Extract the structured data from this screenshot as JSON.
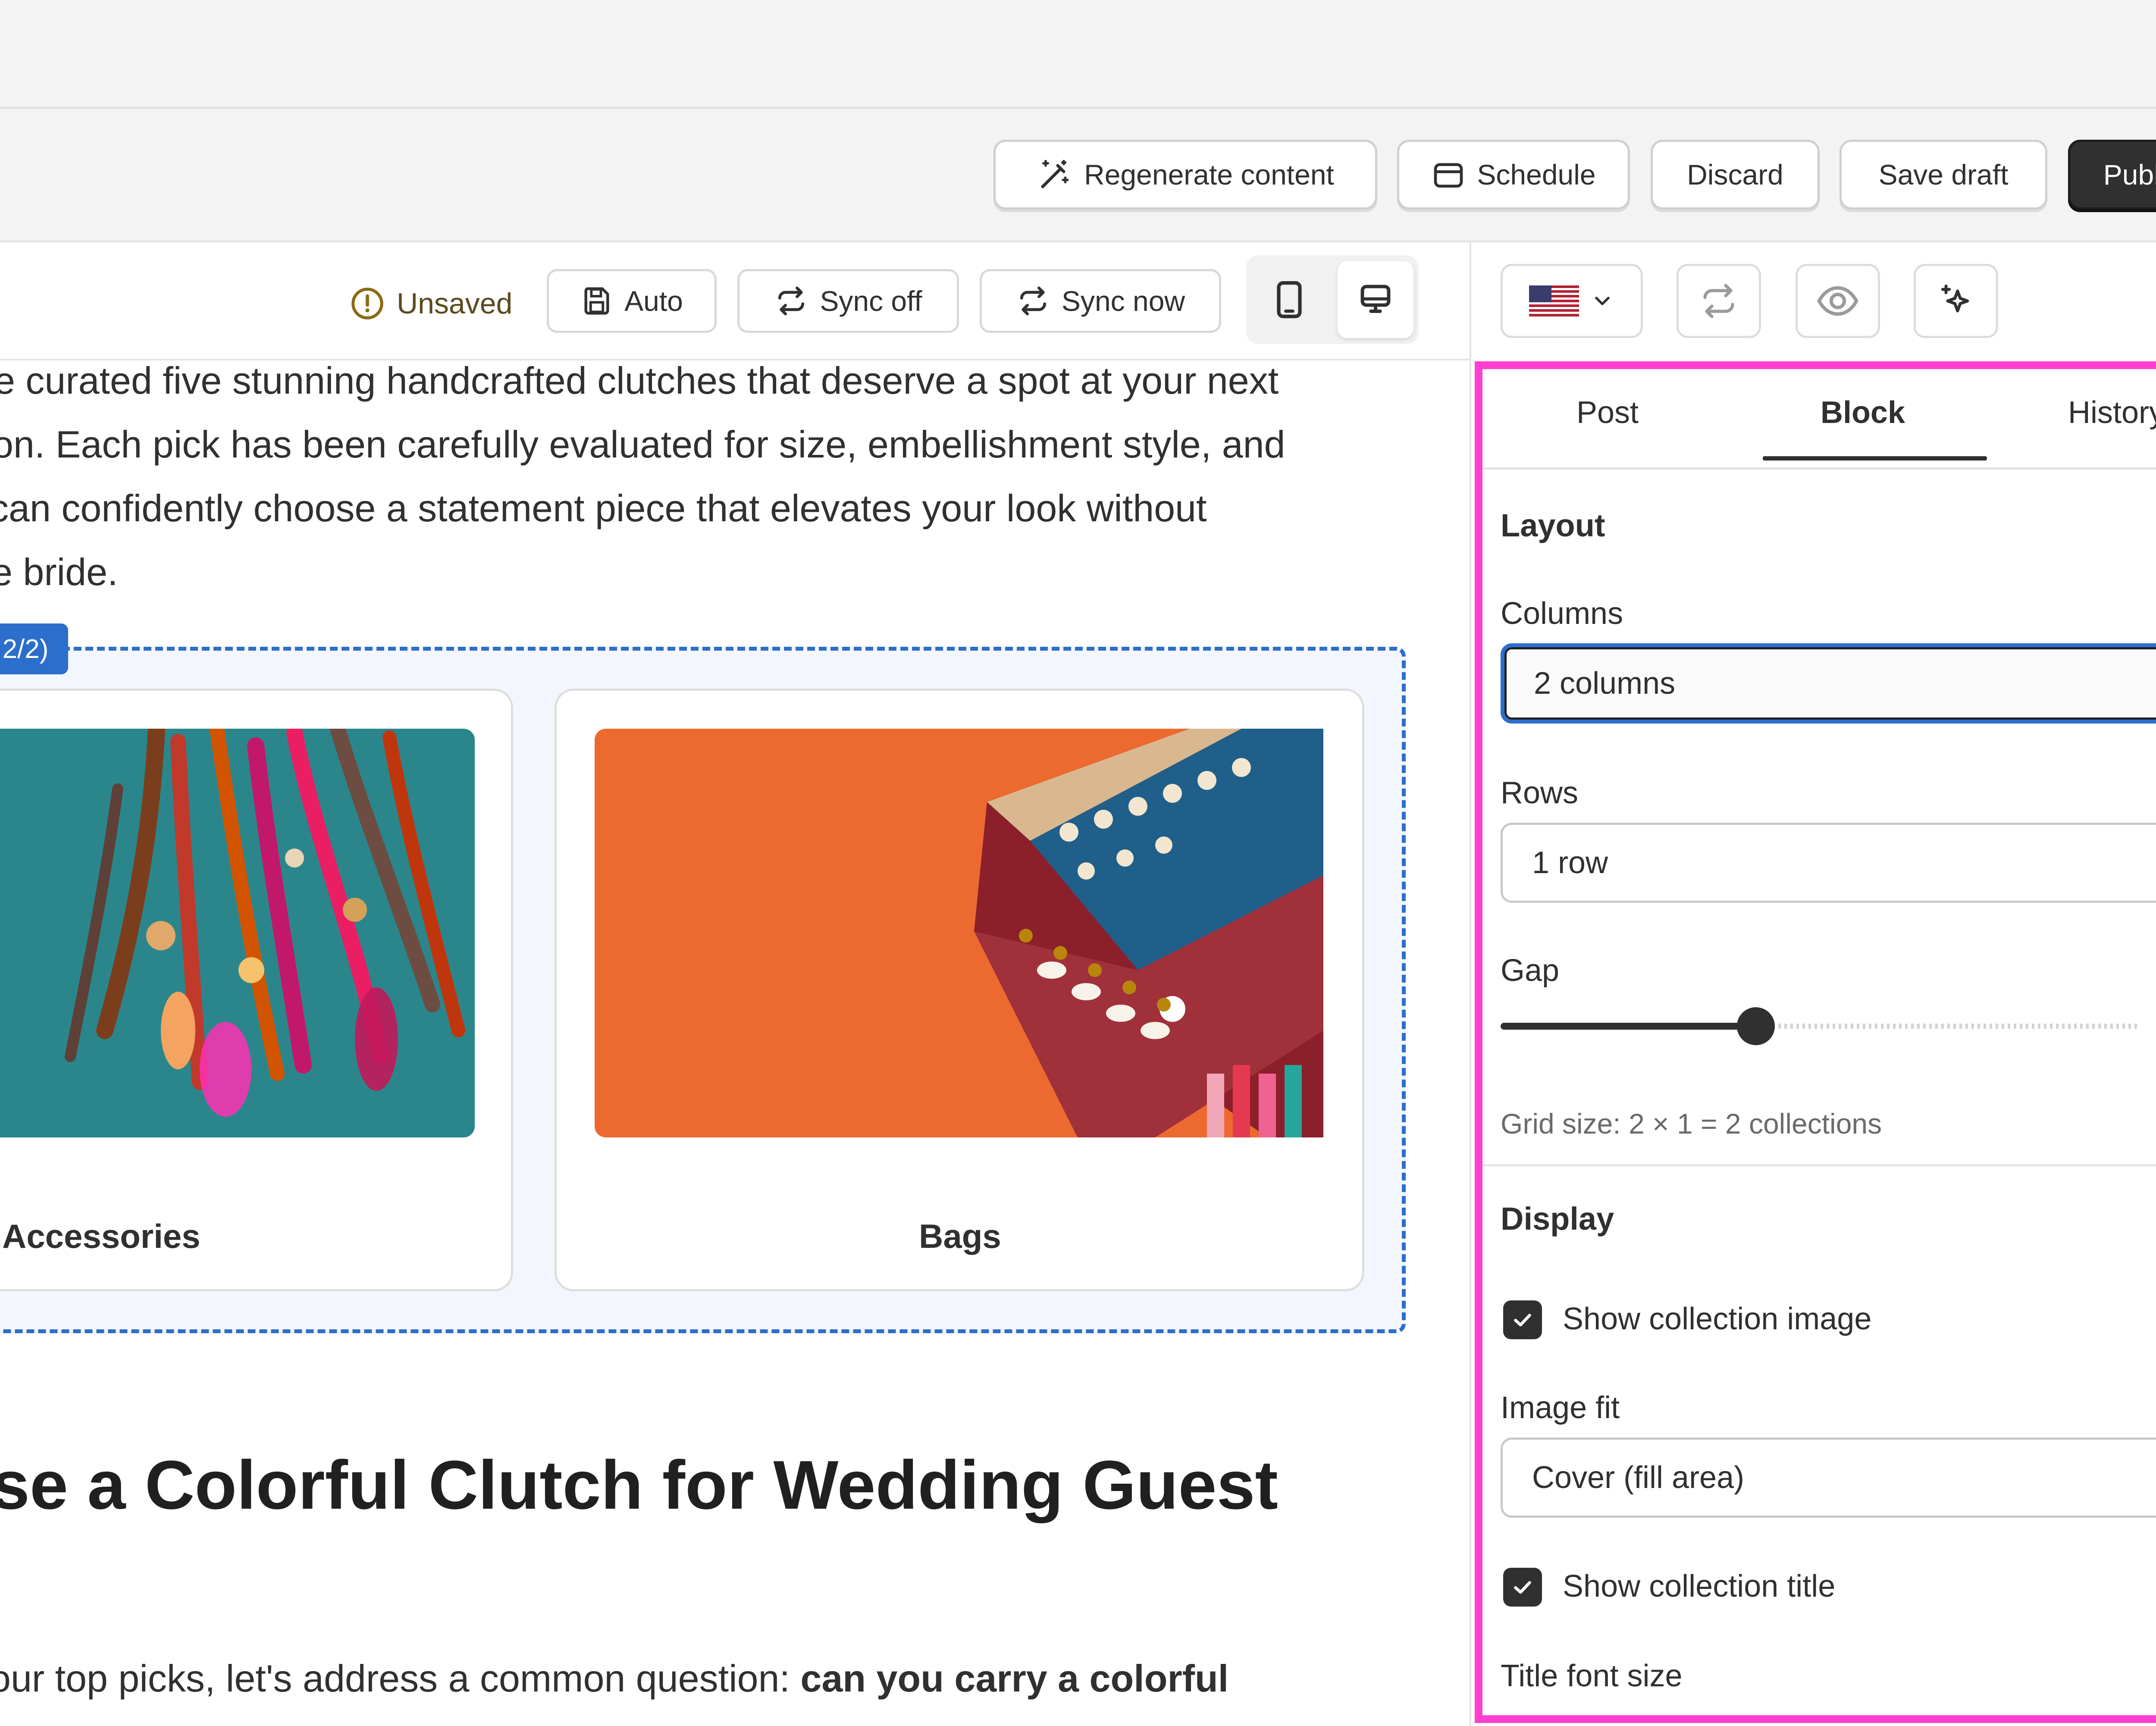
{
  "topbar": {
    "close_icon": "close-icon"
  },
  "actions": {
    "regenerate_label": "Regenerate content",
    "schedule_label": "Schedule",
    "discard_label": "Discard",
    "save_draft_label": "Save draft",
    "publish_label": "Publish"
  },
  "editor_toolbar": {
    "status_label": "Unsaved",
    "auto_label": "Auto",
    "sync_off_label": "Sync off",
    "sync_now_label": "Sync now",
    "device_modes": [
      "mobile-icon",
      "desktop-icon"
    ],
    "active_device": "desktop"
  },
  "content": {
    "paragraph_lines": [
      "e curated five stunning handcrafted clutches that deserve a spot at your next",
      "on. Each pick has been carefully evaluated for size, embellishment style, and",
      "can confidently choose a statement piece that elevates your look without",
      "e bride."
    ],
    "block_tag": "2/2)",
    "cards": [
      {
        "label": "Accessories",
        "image": "feather-earrings-image"
      },
      {
        "label": "Bags",
        "image": "embroidered-clutch-image"
      }
    ],
    "heading": "se a Colorful Clutch for Wedding Guest",
    "last_line_normal": "our top picks, let's address a common question: ",
    "last_line_bold": "can you carry a colorful"
  },
  "sidebar": {
    "locale_flag": "us-flag-icon",
    "tabs": [
      {
        "label": "Post",
        "active": false
      },
      {
        "label": "Block",
        "active": true
      },
      {
        "label": "History",
        "active": false
      }
    ],
    "layout": {
      "title": "Layout",
      "columns_label": "Columns",
      "columns_value": "2 columns",
      "rows_label": "Rows",
      "rows_value": "1 row",
      "gap_label": "Gap",
      "gap_value": "16px",
      "gap_fraction": 0.4,
      "grid_size_text": "Grid size: 2 × 1 = 2 collections"
    },
    "display": {
      "title": "Display",
      "show_image_label": "Show collection image",
      "show_image_checked": true,
      "image_fit_label": "Image fit",
      "image_fit_value": "Cover (fill area)",
      "show_title_label": "Show collection title",
      "show_title_checked": true,
      "title_font_size_label": "Title font size"
    }
  },
  "colors": {
    "accent": "#2c6ecb",
    "highlight": "#ff3fcf",
    "publish_bg": "#303030"
  }
}
